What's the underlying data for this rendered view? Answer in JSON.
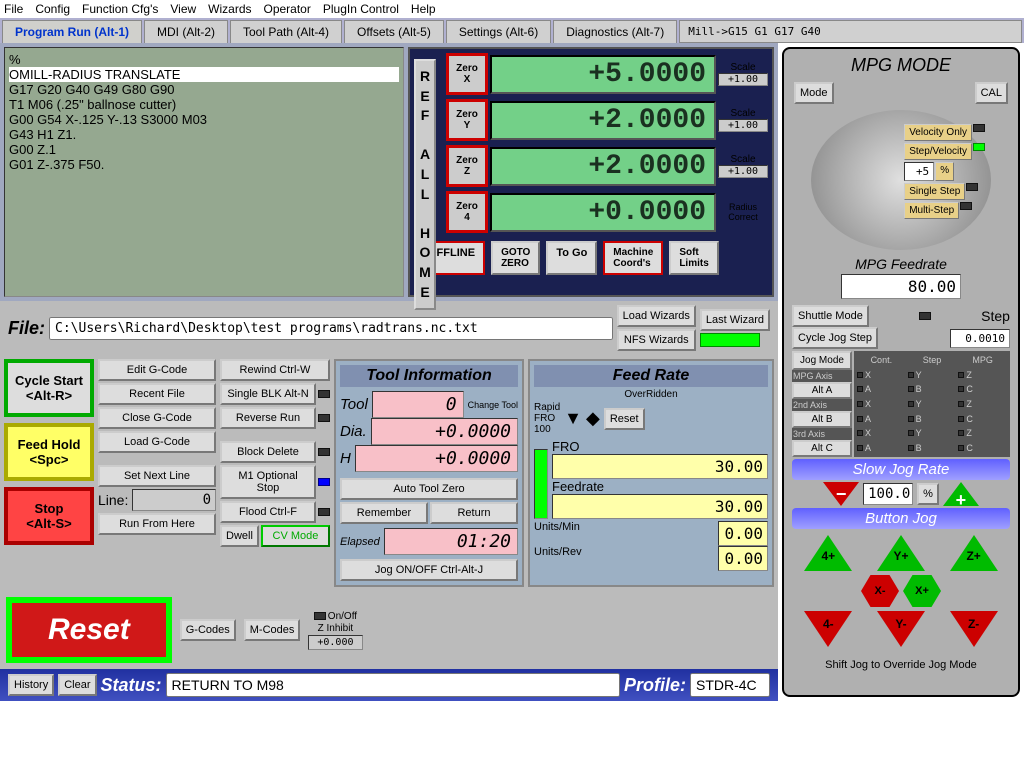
{
  "menubar": [
    "File",
    "Config",
    "Function Cfg's",
    "View",
    "Wizards",
    "Operator",
    "PlugIn Control",
    "Help"
  ],
  "tabs": {
    "items": [
      "Program Run (Alt-1)",
      "MDI (Alt-2)",
      "Tool Path (Alt-4)",
      "Offsets (Alt-5)",
      "Settings (Alt-6)",
      "Diagnostics (Alt-7)"
    ],
    "active_index": 0,
    "tail": "Mill->G15  G1 G17 G40"
  },
  "gcode": {
    "pre": "%",
    "highlight": "OMILL-RADIUS TRANSLATE",
    "rest": "G17 G20 G40 G49 G80 G90\nT1 M06 (.25\" ballnose cutter)\nG00 G54 X-.125 Y-.13 S3000 M03\nG43 H1 Z1.\nG00 Z.1\nG01 Z-.375 F50."
  },
  "refhome": "R\nE\nF\n \nA\nL\nL\n \nH\nO\nM\nE",
  "dro": [
    {
      "zero": "Zero\nX",
      "val": "+5.0000",
      "scale_lbl": "Scale",
      "scale": "+1.00"
    },
    {
      "zero": "Zero\nY",
      "val": "+2.0000",
      "scale_lbl": "Scale",
      "scale": "+1.00"
    },
    {
      "zero": "Zero\nZ",
      "val": "+2.0000",
      "scale_lbl": "Scale",
      "scale": "+1.00"
    },
    {
      "zero": "Zero\n4",
      "val": "+0.0000",
      "scale_lbl": "Radius\nCorrect",
      "scale": ""
    }
  ],
  "dro_btns": {
    "offline": "OFFLINE",
    "gotoz": "GOTO\nZERO",
    "togo": "To Go",
    "machine": "Machine\nCoord's",
    "soft": "Soft\nLimits"
  },
  "file": {
    "label": "File:",
    "path": "C:\\Users\\Richard\\Desktop\\test programs\\radtrans.nc.txt"
  },
  "wizards": {
    "load": "Load Wizards",
    "nfs": "NFS Wizards",
    "last": "Last Wizard"
  },
  "run_btns": {
    "cycle": "Cycle Start\n<Alt-R>",
    "feedhold": "Feed Hold\n<Spc>",
    "stop": "Stop\n<Alt-S>"
  },
  "edit_btns": [
    "Edit G-Code",
    "Recent File",
    "Close G-Code",
    "Load G-Code",
    "Set Next Line",
    "Run From Here"
  ],
  "edit_btns2": [
    "Rewind Ctrl-W",
    "Single BLK Alt-N",
    "Reverse Run",
    "Block Delete",
    "M1 Optional Stop",
    "Flood Ctrl-F"
  ],
  "line": {
    "label": "Line:",
    "val": "0"
  },
  "dwell": {
    "dwell": "Dwell",
    "cv": "CV Mode",
    "onoff": "On/Off",
    "zinhibit": "Z Inhibit",
    "zval": "+0.000"
  },
  "codes": {
    "g": "G-Codes",
    "m": "M-Codes"
  },
  "reset": "Reset",
  "tool": {
    "title": "Tool Information",
    "tool_lbl": "Tool",
    "tool_val": "0",
    "change": "Change\nTool",
    "dia_lbl": "Dia.",
    "dia_val": "+0.0000",
    "h_lbl": "H",
    "h_val": "+0.0000",
    "auto": "Auto Tool Zero",
    "remember": "Remember",
    "return": "Return",
    "elapsed_lbl": "Elapsed",
    "elapsed": "01:20",
    "jog": "Jog ON/OFF Ctrl-Alt-J"
  },
  "feed": {
    "title": "Feed Rate",
    "overridden": "OverRidden",
    "rapid": "Rapid",
    "fro_lbl": "FRO",
    "fro100": "100",
    "reset": "Reset",
    "fro": "FRO",
    "fro_val": "30.00",
    "feedrate": "Feedrate",
    "fr_val": "30.00",
    "upm": "Units/Min",
    "upm_val": "0.00",
    "upr": "Units/Rev",
    "upr_val": "0.00"
  },
  "status": {
    "history": "History",
    "clear": "Clear",
    "label": "Status:",
    "val": "RETURN TO M98",
    "profile_lbl": "Profile:",
    "profile": "STDR-4C"
  },
  "mpg": {
    "title": "MPG MODE",
    "mode": "Mode",
    "cal": "CAL",
    "velonly": "Velocity Only",
    "stepvel": "Step/Velocity",
    "stepval": "+5",
    "pct": "%",
    "single": "Single Step",
    "multi": "Multi-Step",
    "feedrate_lbl": "MPG Feedrate",
    "feedrate": "80.00",
    "shuttle": "Shuttle Mode",
    "step_lbl": "Step",
    "cycle": "Cycle Jog Step",
    "cycle_val": "0.0010",
    "jogmode": "Jog Mode",
    "cont": "Cont.",
    "step": "Step",
    "mpg_hdr": "MPG",
    "mpgaxis": "MPG Axis",
    "a": "Alt A",
    "a2": "2nd Axis",
    "b": "Alt B",
    "a3": "3rd Axis",
    "c": "Alt C",
    "slow": "Slow Jog Rate",
    "slow_val": "100.0",
    "slow_pct": "%",
    "btnjog": "Button Jog",
    "j4p": "4+",
    "jyp": "Y+",
    "jzp": "Z+",
    "jxm": "X-",
    "jxp": "X+",
    "j4m": "4-",
    "jym": "Y-",
    "jzm": "Z-",
    "footer": "Shift Jog to Override Jog Mode"
  }
}
